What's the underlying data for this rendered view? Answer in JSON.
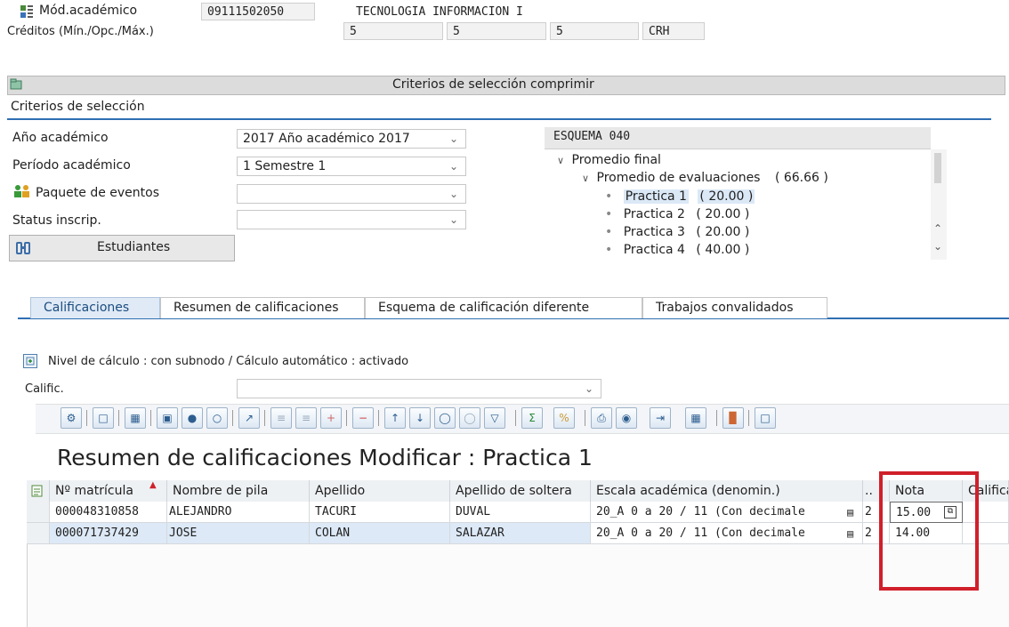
{
  "header": {
    "modulo_label": "Mód.académico",
    "modulo_code": "09111502050",
    "modulo_name": "TECNOLOGIA INFORMACION I",
    "creditos_label": "Créditos (Mín./Opc./Máx.)",
    "cred_min": "5",
    "cred_opc": "5",
    "cred_max": "5",
    "cred_unit": "CRH"
  },
  "criteria_bar": {
    "title": "Criterios de selección comprimir"
  },
  "criteria": {
    "section_title": "Criterios de selección",
    "ano_label": "Año académico",
    "ano_value": "2017 Año académico 2017",
    "periodo_label": "Período académico",
    "periodo_value": "1 Semestre 1",
    "paquete_label": "Paquete de eventos",
    "paquete_value": "",
    "status_label": "Status inscrip.",
    "status_value": "",
    "estudiantes_button": "Estudiantes"
  },
  "scheme": {
    "title": "ESQUEMA 040",
    "root": "Promedio final",
    "child": "Promedio de evaluaciones",
    "child_value": "( 66.66 )",
    "items": [
      {
        "name": "Practica 1",
        "value": "( 20.00 )"
      },
      {
        "name": "Practica 2",
        "value": "( 20.00 )"
      },
      {
        "name": "Practica 3",
        "value": "( 20.00 )"
      },
      {
        "name": "Practica 4",
        "value": "( 40.00 )"
      }
    ]
  },
  "tabs": [
    {
      "label": "Calificaciones"
    },
    {
      "label": "Resumen de calificaciones"
    },
    {
      "label": "Esquema de calificación diferente"
    },
    {
      "label": "Trabajos convalidados"
    }
  ],
  "calc": {
    "nivel_text": "Nivel de cálculo : con subnodo / Cálculo automático : activado",
    "calific_label": "Calific.",
    "calific_value": ""
  },
  "report": {
    "title": "Resumen de calificaciones Modificar : Practica 1"
  },
  "table": {
    "headers": {
      "matricula": "Nº matrícula",
      "nombre": "Nombre de pila",
      "apellido": "Apellido",
      "soltera": "Apellido de soltera",
      "escala": "Escala académica (denomin.)",
      "dots": "..",
      "nota": "Nota",
      "calif": "Calificación"
    },
    "rows": [
      {
        "matricula": "000048310858",
        "nombre": "ALEJANDRO",
        "apellido": "TACURI",
        "soltera": "DUVAL",
        "escala": "20_A 0 a 20 / 11 (Con decimale",
        "code": "2",
        "nota": "15.00"
      },
      {
        "matricula": "000071737429",
        "nombre": "JOSE",
        "apellido": "COLAN",
        "soltera": "SALAZAR",
        "escala": "20_A 0 a 20 / 11 (Con decimale",
        "code": "2",
        "nota": "14.00"
      }
    ]
  },
  "colors": {
    "accent_blue": "#2f6fb3",
    "highlight_red": "#d0202b",
    "selected_tab": "#dfeaf6",
    "selected_row": "#dde9f6"
  }
}
